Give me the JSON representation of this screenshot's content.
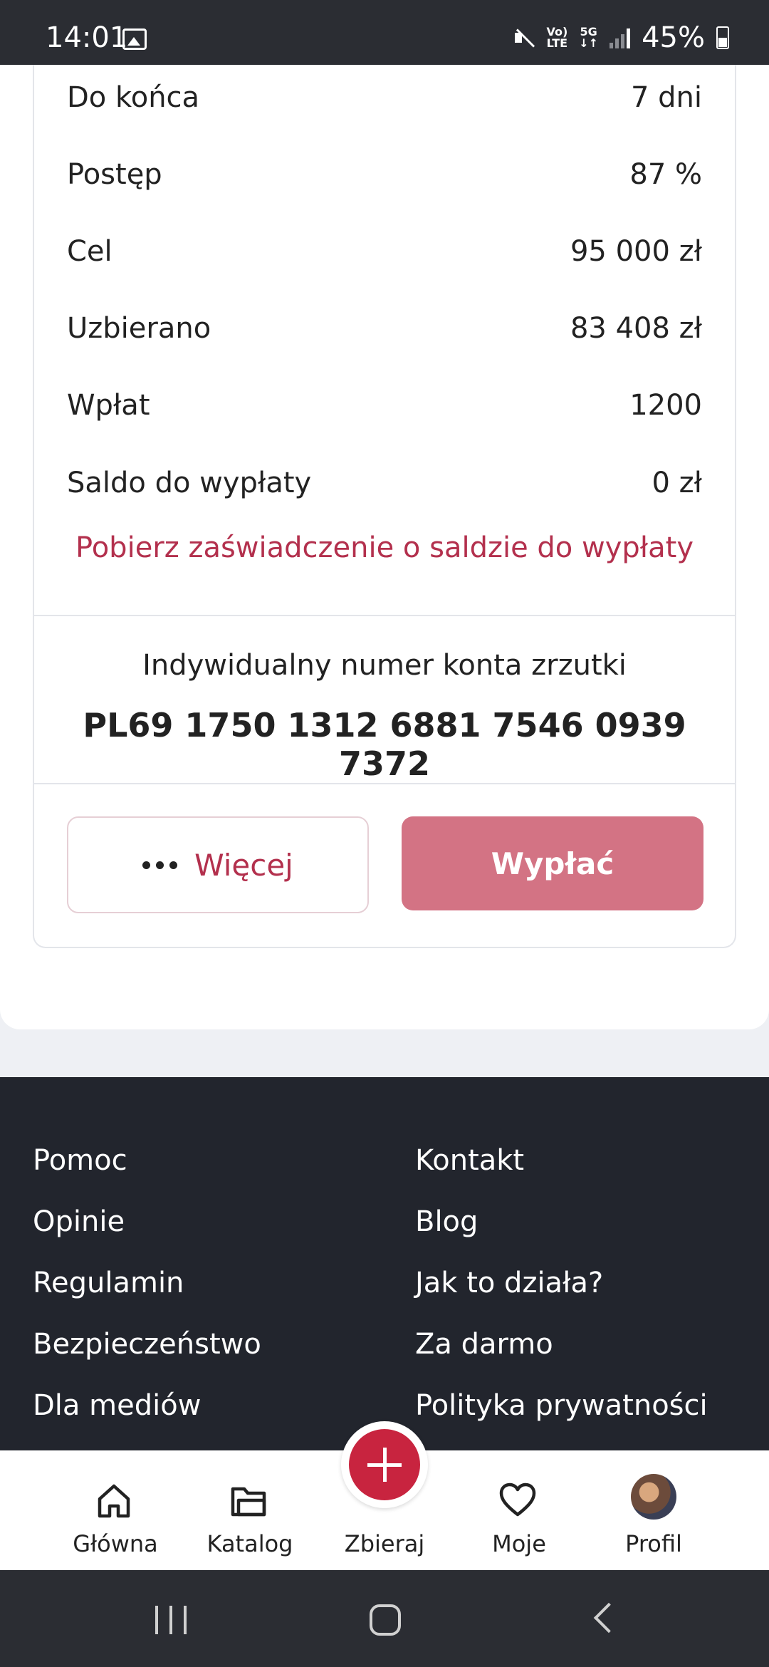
{
  "status_bar": {
    "time": "14:01",
    "network_top": "Vo)",
    "network_bottom": "LTE",
    "gen_top": "5G",
    "gen_bottom": "↓↑",
    "battery": "45%"
  },
  "details": [
    {
      "label": "Do końca",
      "value": "7 dni"
    },
    {
      "label": "Postęp",
      "value": "87 %"
    },
    {
      "label": "Cel",
      "value": "95 000 zł"
    },
    {
      "label": "Uzbierano",
      "value": "83 408 zł"
    },
    {
      "label": "Wpłat",
      "value": "1200"
    },
    {
      "label": "Saldo do wypłaty",
      "value": "0 zł"
    }
  ],
  "download_link": "Pobierz zaświadczenie o saldzie do wypłaty",
  "account": {
    "label": "Indywidualny numer konta zrzutki",
    "number": "PL69 1750 1312 6881 7546 0939 7372"
  },
  "buttons": {
    "more": "Więcej",
    "withdraw": "Wypłać"
  },
  "footer": {
    "left": [
      "Pomoc",
      "Opinie",
      "Regulamin",
      "Bezpieczeństwo",
      "Dla mediów"
    ],
    "right": [
      "Kontakt",
      "Blog",
      "Jak to działa?",
      "Za darmo",
      "Polityka prywatności"
    ]
  },
  "bottom_nav": {
    "home": "Główna",
    "catalog": "Katalog",
    "collect": "Zbieraj",
    "mine": "Moje",
    "profile": "Profil"
  },
  "colors": {
    "accent": "#c8243f",
    "link": "#b3304d",
    "withdraw_button": "#d37384",
    "footer_bg": "#22252d"
  }
}
